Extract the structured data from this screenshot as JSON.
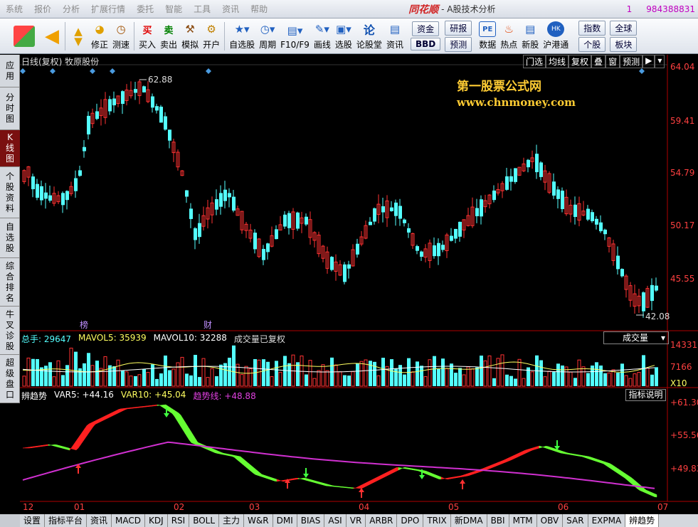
{
  "menubar": {
    "items": [
      "系统",
      "报价",
      "分析",
      "扩展行情",
      "委托",
      "智能",
      "工具",
      "资讯",
      "帮助"
    ],
    "brand": "同花顺",
    "app_title": "- A股技术分析",
    "number1": "1",
    "number2": "984388831"
  },
  "toolbar": {
    "buttons": [
      "修正",
      "测速",
      "买入",
      "卖出",
      "模拟",
      "开户",
      "自选股",
      "周期",
      "F10/F9",
      "画线",
      "选股",
      "论股堂",
      "资讯",
      "数据",
      "热点",
      "新股",
      "沪港通"
    ],
    "boxes": [
      "资金",
      "BBD",
      "研报",
      "预测",
      "指数",
      "个股",
      "全球",
      "板块"
    ]
  },
  "lefttabs": [
    {
      "label": "应用",
      "active": false
    },
    {
      "label": "分时图",
      "active": false
    },
    {
      "label": "K线图",
      "active": true
    },
    {
      "label": "个股资料",
      "active": false
    },
    {
      "label": "自选股",
      "active": false
    },
    {
      "label": "综合排名",
      "active": false
    },
    {
      "label": "牛叉诊股",
      "active": false
    },
    {
      "label": "超级盘口",
      "active": false
    }
  ],
  "chart_header": {
    "title": "日线(复权) 牧原股份",
    "right_buttons": [
      "门选",
      "均线",
      "复权",
      "叠",
      "窗",
      "预测"
    ],
    "high_label": "62.88",
    "low_label": "42.08",
    "marker_bang": "榜",
    "marker_cai": "财",
    "watermark_1": "第一股票公式网",
    "watermark_2": "www.chnmoney.com"
  },
  "price_axis": [
    "64.04",
    "59.41",
    "54.79",
    "50.17",
    "45.55",
    "42.08"
  ],
  "volume": {
    "total": "总手: 29647",
    "mavol5": "MAVOL5: 35939",
    "mavol10": "MAVOL10: 32288",
    "note": "成交量已复权",
    "dropdown": "成交量",
    "axis": [
      "14331",
      "7166",
      "X10"
    ]
  },
  "indicator": {
    "name": "辨趋势",
    "var5": "VAR5: +44.16",
    "var10": "VAR10: +45.04",
    "trend": "趋势线: +48.88",
    "explain_button": "指标说明",
    "axis": [
      "+61.30",
      "+55.56",
      "+49.83"
    ]
  },
  "x_axis": [
    "12",
    "01",
    "02",
    "03",
    "04",
    "05",
    "06",
    "07"
  ],
  "bottom_tabs": [
    "设置",
    "指标平台",
    "资讯",
    "MACD",
    "KDJ",
    "RSI",
    "BOLL",
    "主力",
    "W&R",
    "DMI",
    "BIAS",
    "ASI",
    "VR",
    "ARBR",
    "DPO",
    "TRIX",
    "新DMA",
    "BBI",
    "MTM",
    "OBV",
    "SAR",
    "EXPMA",
    "辨趋势"
  ],
  "colors": {
    "up": "#ff3232",
    "down": "#54ffff",
    "axis": "#b00000",
    "brand": "#d02020",
    "watermark": "#ffcc33",
    "trend": "#d030d0",
    "green_band": "#66ff33",
    "red_band": "#ff2020"
  }
}
